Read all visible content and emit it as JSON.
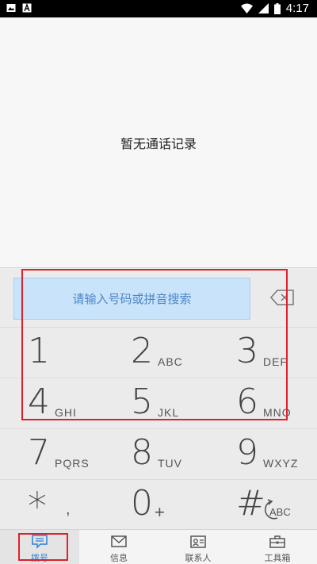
{
  "status_bar": {
    "time": "4:17",
    "left_icons": [
      "image-icon",
      "font-a-icon"
    ],
    "right_icons": [
      "wifi-icon",
      "signal-icon",
      "battery-icon"
    ]
  },
  "history": {
    "empty_text": "暂无通话记录"
  },
  "dialpad": {
    "search_placeholder": "请输入号码或拼音搜索",
    "backspace_icon": "backspace-icon",
    "keys": [
      [
        {
          "digit": "1",
          "letters": ""
        },
        {
          "digit": "2",
          "letters": "ABC"
        },
        {
          "digit": "3",
          "letters": "DEF"
        }
      ],
      [
        {
          "digit": "4",
          "letters": "GHI"
        },
        {
          "digit": "5",
          "letters": "JKL"
        },
        {
          "digit": "6",
          "letters": "MNO"
        }
      ],
      [
        {
          "digit": "7",
          "letters": "PQRS"
        },
        {
          "digit": "8",
          "letters": "TUV"
        },
        {
          "digit": "9",
          "letters": "WXYZ"
        }
      ],
      [
        {
          "digit": "*",
          "letters": ","
        },
        {
          "digit": "0",
          "letters": "+"
        },
        {
          "digit": "#",
          "letters": "",
          "icon": "abc-switch-icon"
        }
      ]
    ]
  },
  "bottom_nav": {
    "items": [
      {
        "label": "拨号",
        "icon": "dial-icon",
        "active": true
      },
      {
        "label": "信息",
        "icon": "message-icon",
        "active": false
      },
      {
        "label": "联系人",
        "icon": "contacts-icon",
        "active": false
      },
      {
        "label": "工具箱",
        "icon": "toolbox-icon",
        "active": false
      }
    ]
  },
  "colors": {
    "accent": "#2b7fd6",
    "search_bg": "#c9e3fb",
    "highlight": "#e0202a"
  }
}
